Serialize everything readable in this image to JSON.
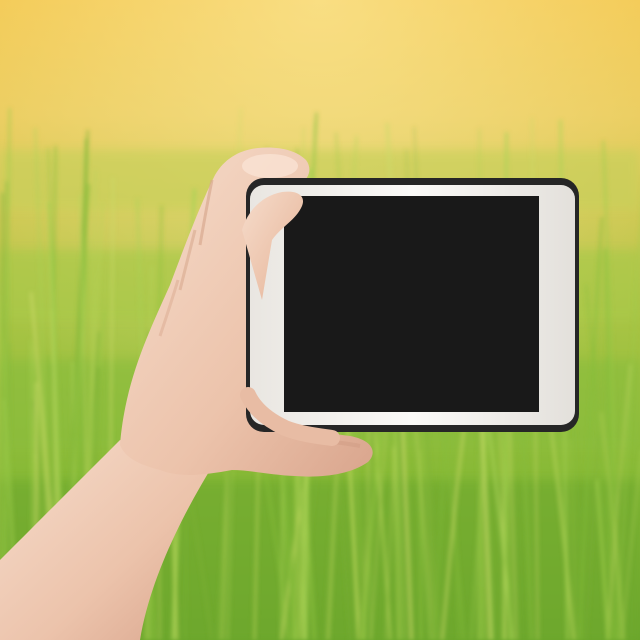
{
  "scene": {
    "description_free": true,
    "palette": {
      "sky_top": "#f0c24a",
      "sky_mid": "#e8c85a",
      "field_light": "#b8c94a",
      "field_mid": "#8fbf3a",
      "field_dark": "#5e9a26",
      "grass_blade": "#a7cf55",
      "skin_light": "#f3d6c4",
      "skin_mid": "#e8bca4",
      "skin_shadow": "#d8a48c",
      "phone_frame": "#f4f1ec",
      "phone_edge": "#2b2b2b",
      "phone_screen": "#141414"
    },
    "icons": {
      "hand": "hand-icon",
      "phone": "smartphone-icon"
    }
  }
}
